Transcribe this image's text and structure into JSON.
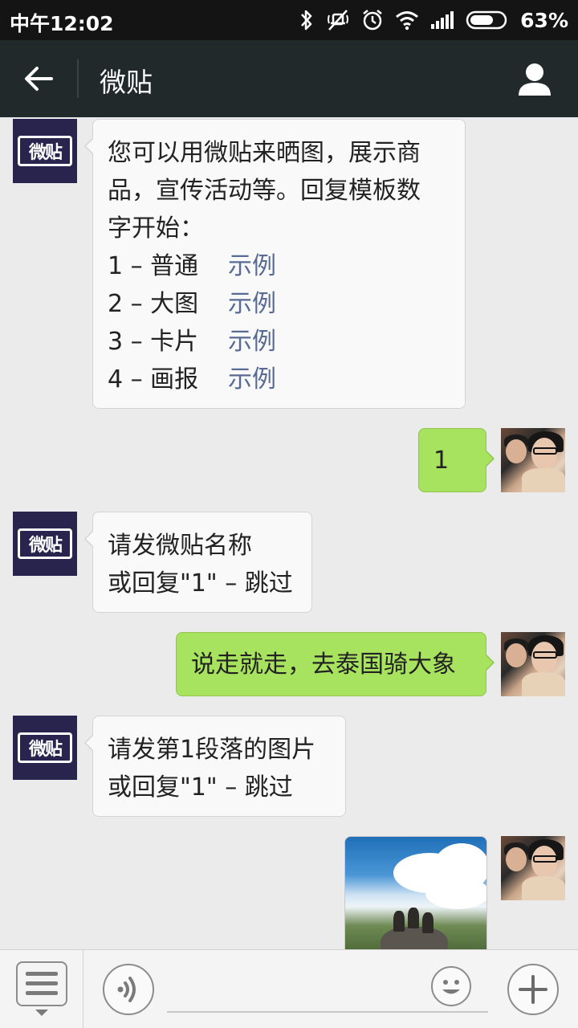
{
  "status_bar": {
    "time": "中午12:02",
    "battery": "63%",
    "icons": [
      "bluetooth-icon",
      "mute-icon",
      "alarm-icon",
      "wifi-icon",
      "signal-icon",
      "battery-icon"
    ]
  },
  "header": {
    "title": "微贴",
    "back_icon": "back-arrow-icon",
    "profile_icon": "person-icon"
  },
  "bot_avatar_text": "微贴",
  "messages": [
    {
      "sender": "bot",
      "lines": [
        "您可以用微贴来晒图，展示商",
        "品，宣传活动等。回复模板数",
        "字开始："
      ],
      "options": [
        {
          "label": "1 – 普通",
          "link": "示例"
        },
        {
          "label": "2 – 大图",
          "link": "示例"
        },
        {
          "label": "3 – 卡片",
          "link": "示例"
        },
        {
          "label": "4 – 画报",
          "link": "示例"
        }
      ]
    },
    {
      "sender": "user",
      "text": "1"
    },
    {
      "sender": "bot",
      "lines": [
        "请发微贴名称",
        "或回复\"1\" – 跳过"
      ]
    },
    {
      "sender": "user",
      "text": "说走就走，去泰国骑大象"
    },
    {
      "sender": "bot",
      "lines": [
        "请发第1段落的图片",
        "或回复\"1\" – 跳过"
      ]
    },
    {
      "sender": "user",
      "type": "image"
    }
  ],
  "input_bar": {
    "menu_icon": "menu-list-icon",
    "voice_icon": "voice-icon",
    "emoji_icon": "emoji-icon",
    "add_icon": "plus-icon",
    "input_value": ""
  },
  "colors": {
    "header_bg": "#21292b",
    "chat_bg": "#ebebeb",
    "user_bubble": "#a8e35f",
    "bot_bubble": "#f9f9f9",
    "link": "#576b95",
    "bot_avatar_bg": "#28244d"
  }
}
